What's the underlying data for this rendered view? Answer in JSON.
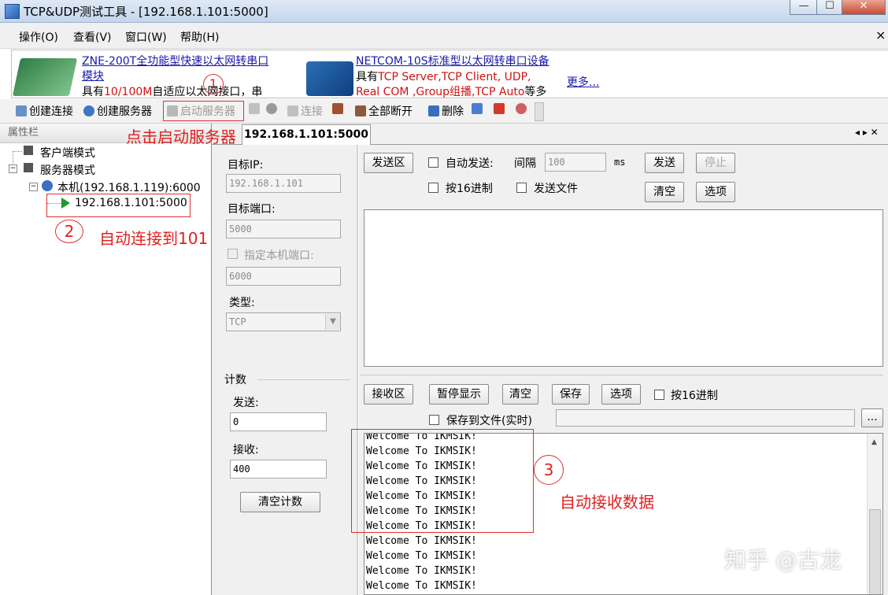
{
  "window": {
    "title": "TCP&UDP测试工具 - [192.168.1.101:5000]",
    "min": "—",
    "max": "☐",
    "close": "✕"
  },
  "menu": {
    "items": [
      "操作(O)",
      "查看(V)",
      "窗口(W)",
      "帮助(H)"
    ],
    "close": "×"
  },
  "ads": {
    "ad1_title": "ZNE-200T全功能型快速以太网转串口",
    "ad1_title2": "模块",
    "ad1_text_a": "具有",
    "ad1_text_red": "10/100M",
    "ad1_text_b": "自适应以太网接口，串",
    "ad2_title": "NETCOM-10S标准型以太网转串口设备",
    "ad2_text_a": "具有",
    "ad2_text_red": "TCP Server,TCP Client, UDP,",
    "ad2_text_red2": "Real COM ,Group组播,TCP Auto",
    "ad2_text_b": "等多",
    "more": "更多..."
  },
  "toolbar": {
    "create_connection": "创建连接",
    "create_server": "创建服务器",
    "start_server": "启动服务器",
    "connect": "连接",
    "disconnect_all": "全部断开",
    "delete": "删除"
  },
  "sidebar": {
    "header": "属性栏",
    "client_mode": "客户端模式",
    "server_mode": "服务器模式",
    "local": "本机(192.168.1.119):6000",
    "remote": "192.168.1.101:5000"
  },
  "tab": {
    "active": "192.168.1.101:5000",
    "nav": "◂ ▸ ✕"
  },
  "config": {
    "target_ip_label": "目标IP:",
    "target_ip": "192.168.1.101",
    "target_port_label": "目标端口:",
    "target_port": "5000",
    "local_port_label": "指定本机端口:",
    "local_port": "6000",
    "type_label": "类型:",
    "type": "TCP"
  },
  "counter": {
    "title": "计数",
    "send_label": "发送:",
    "send": "0",
    "recv_label": "接收:",
    "recv": "400",
    "clear": "清空计数"
  },
  "send_area": {
    "label": "发送区",
    "auto_send": "自动发送:",
    "interval_label": "间隔",
    "interval": "100",
    "ms": "ms",
    "send": "发送",
    "stop": "停止",
    "hex": "按16进制",
    "send_file": "发送文件",
    "clear": "清空",
    "options": "选项"
  },
  "recv_area": {
    "label": "接收区",
    "pause": "暂停显示",
    "clear": "清空",
    "save": "保存",
    "options": "选项",
    "hex": "按16进制",
    "save_file": "保存到文件(实时)",
    "browse": "...",
    "lines": [
      "Welcome To IKMSIK!",
      "Welcome To IKMSIK!",
      "Welcome To IKMSIK!",
      "Welcome To IKMSIK!",
      "Welcome To IKMSIK!",
      "Welcome To IKMSIK!",
      "Welcome To IKMSIK!",
      "Welcome To IKMSIK!",
      "Welcome To IKMSIK!",
      "Welcome To IKMSIK!",
      "Welcome To IKMSIK!"
    ]
  },
  "annotations": {
    "step1_num": "1",
    "step1_text": "点击启动服务器",
    "step2_num": "2",
    "step2_text": "自动连接到101",
    "step3_num": "3",
    "step3_text": "自动接收数据"
  },
  "watermark": "知乎 @古龙"
}
